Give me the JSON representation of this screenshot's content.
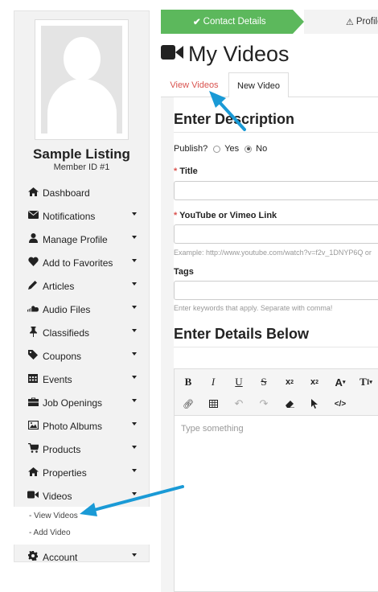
{
  "sidebar": {
    "listing_name": "Sample Listing",
    "member_id": "Member ID #1",
    "items": [
      {
        "label": "Dashboard",
        "icon": "home-icon"
      },
      {
        "label": "Notifications",
        "icon": "envelope-icon"
      },
      {
        "label": "Manage Profile",
        "icon": "user-icon"
      },
      {
        "label": "Add to Favorites",
        "icon": "heart-icon"
      },
      {
        "label": "Articles",
        "icon": "pencil-icon"
      },
      {
        "label": "Audio Files",
        "icon": "soundcloud-icon"
      },
      {
        "label": "Classifieds",
        "icon": "pushpin-icon"
      },
      {
        "label": "Coupons",
        "icon": "tag-icon"
      },
      {
        "label": "Events",
        "icon": "calendar-icon"
      },
      {
        "label": "Job Openings",
        "icon": "briefcase-icon"
      },
      {
        "label": "Photo Albums",
        "icon": "picture-icon"
      },
      {
        "label": "Products",
        "icon": "cart-icon"
      },
      {
        "label": "Properties",
        "icon": "home-icon"
      },
      {
        "label": "Videos",
        "icon": "video-camera-icon"
      }
    ],
    "videos_sub": [
      "- View Videos",
      "- Add Video"
    ],
    "account_label": "Account"
  },
  "steps": {
    "step1": "Contact Details",
    "step2": "Profile"
  },
  "page": {
    "title": "My Videos",
    "tabs": [
      "View Videos",
      "New Video"
    ]
  },
  "form": {
    "section1": "Enter Description",
    "publish_label": "Publish?",
    "publish_yes": "Yes",
    "publish_no": "No",
    "publish_value": "No",
    "title_label": "Title",
    "link_label": "YouTube or Vimeo Link",
    "link_hint": "Example: http://www.youtube.com/watch?v=f2v_1DNYP6Q or",
    "tags_label": "Tags",
    "tags_hint": "Enter keywords that apply. Separate with comma!",
    "section2": "Enter Details Below",
    "editor_placeholder": "Type something"
  },
  "colors": {
    "step_active": "#5cb85c",
    "tab_active_text": "#d9534f",
    "annotation_arrow": "#1a9ad6"
  }
}
